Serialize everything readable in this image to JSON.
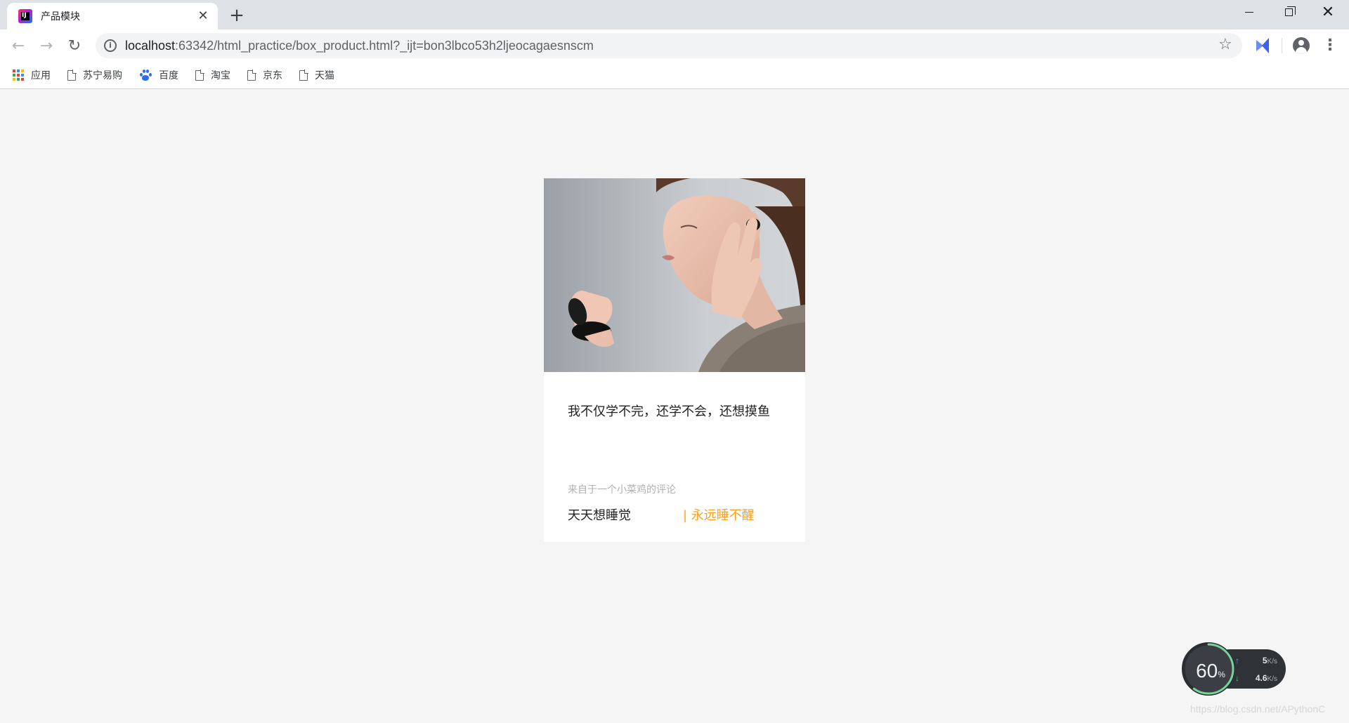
{
  "browser": {
    "tab": {
      "title": "产品模块",
      "close_glyph": "✕"
    },
    "new_tab_glyph": "+",
    "window_controls": {
      "close_glyph": "✕"
    },
    "nav": {
      "back_glyph": "←",
      "forward_glyph": "→",
      "reload_glyph": "↻"
    },
    "address": {
      "host": "localhost",
      "rest": ":63342/html_practice/box_product.html?_ijt=bon3lbco53h2ljeocagaesnscm"
    },
    "star_glyph": "☆",
    "menu_glyph": "⋮",
    "bookmarks": [
      {
        "label": "应用",
        "icon": "apps-grid-icon"
      },
      {
        "label": "苏宁易购",
        "icon": "page-icon"
      },
      {
        "label": "百度",
        "icon": "baidu-paw-icon"
      },
      {
        "label": "淘宝",
        "icon": "page-icon"
      },
      {
        "label": "京东",
        "icon": "page-icon"
      },
      {
        "label": "天猫",
        "icon": "page-icon"
      }
    ]
  },
  "card": {
    "image": "woman-with-earbud-photo",
    "headline": "我不仅学不完，还学不会，还想摸鱼",
    "source": "来自于一个小菜鸡的评论",
    "author": "天天想睡觉",
    "tag": "| 永远睡不醒"
  },
  "speed_widget": {
    "percent": "60",
    "percent_unit": "%",
    "upload": {
      "value": "5",
      "unit": "K/s"
    },
    "download": {
      "value": "4.6",
      "unit": "K/s"
    },
    "up_glyph": "↑",
    "down_glyph": "↓"
  },
  "watermark": "https://blog.csdn.net/APythonC",
  "colors": {
    "page_background": "#f5f5f5",
    "tag_orange": "#ff9f1a",
    "source_gray": "#b0b0b0"
  }
}
